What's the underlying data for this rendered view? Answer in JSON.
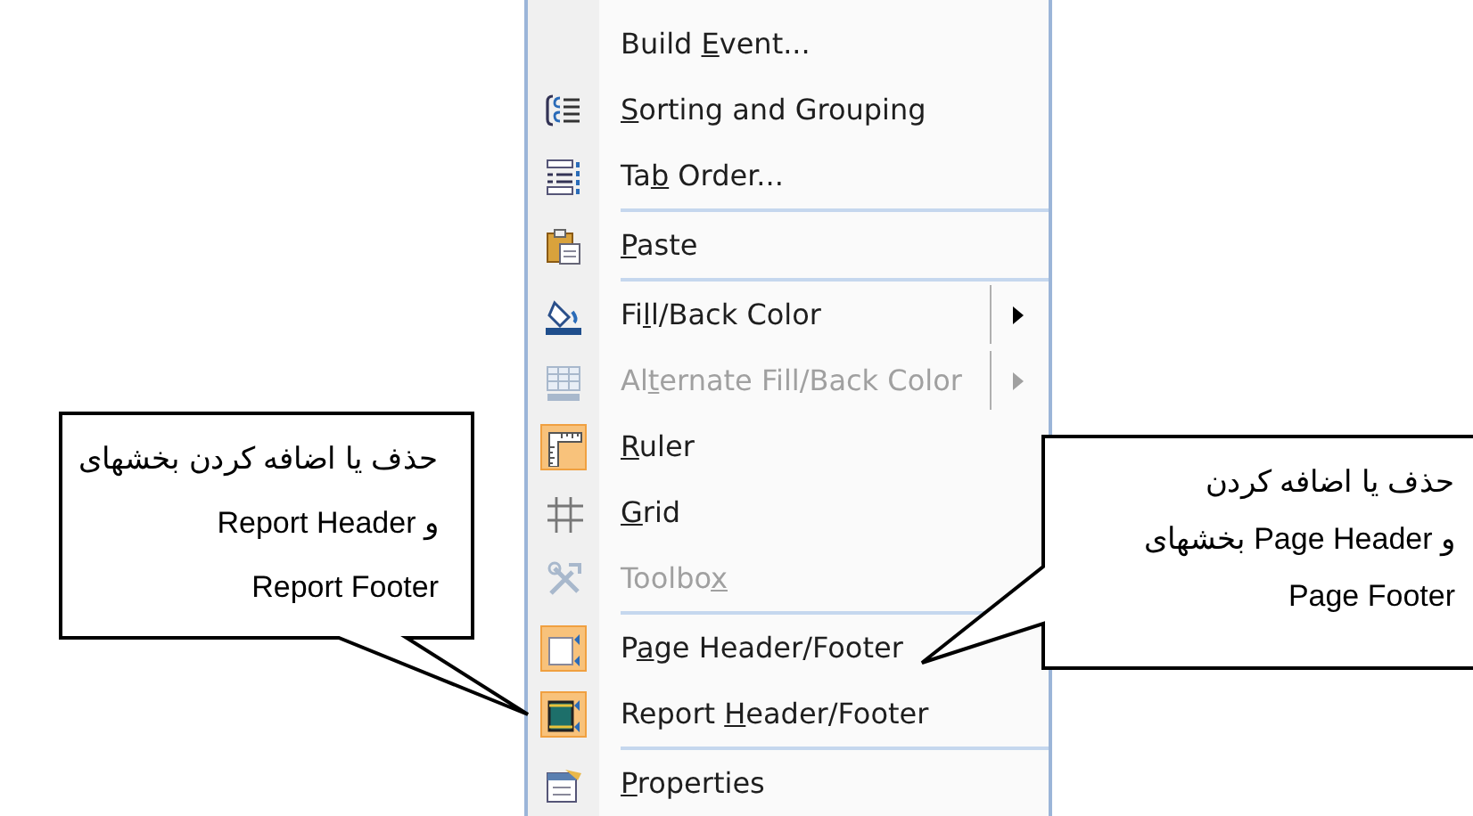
{
  "menu": {
    "items": [
      {
        "kind": "command",
        "label": {
          "before": "Build ",
          "key": "E",
          "after": "vent..."
        },
        "disabled": false,
        "checked": false,
        "submenu": false
      },
      {
        "kind": "command",
        "label": {
          "key": "S",
          "after": "orting and Grouping"
        },
        "disabled": false,
        "checked": false,
        "submenu": false
      },
      {
        "kind": "command",
        "label": {
          "before": "Ta",
          "key": "b",
          "after": " Order..."
        },
        "disabled": false,
        "checked": false,
        "submenu": false
      },
      {
        "kind": "separator"
      },
      {
        "kind": "command",
        "label": {
          "key": "P",
          "after": "aste"
        },
        "disabled": false,
        "checked": false,
        "submenu": false
      },
      {
        "kind": "separator"
      },
      {
        "kind": "command",
        "label": {
          "before": "Fi",
          "key": "l",
          "after": "l/Back Color"
        },
        "disabled": false,
        "checked": false,
        "submenu": true
      },
      {
        "kind": "command",
        "label": {
          "before": "Al",
          "key": "t",
          "after": "ernate Fill/Back Color"
        },
        "disabled": true,
        "checked": false,
        "submenu": true
      },
      {
        "kind": "command",
        "label": {
          "key": "R",
          "after": "uler"
        },
        "disabled": false,
        "checked": true,
        "submenu": false
      },
      {
        "kind": "command",
        "label": {
          "key": "G",
          "after": "rid"
        },
        "disabled": false,
        "checked": false,
        "submenu": false
      },
      {
        "kind": "command",
        "label": {
          "before": "Toolbo",
          "key": "x"
        },
        "disabled": true,
        "checked": false,
        "submenu": false
      },
      {
        "kind": "separator"
      },
      {
        "kind": "command",
        "label": {
          "before": "P",
          "key": "a",
          "after": "ge Header/Footer"
        },
        "disabled": false,
        "checked": true,
        "submenu": false
      },
      {
        "kind": "command",
        "label": {
          "before": "Report ",
          "key": "H",
          "after": "eader/Footer"
        },
        "disabled": false,
        "checked": true,
        "submenu": false
      },
      {
        "kind": "separator"
      },
      {
        "kind": "command",
        "label": {
          "key": "P",
          "after": "roperties"
        },
        "disabled": false,
        "checked": false,
        "submenu": false
      }
    ]
  },
  "callouts": [
    {
      "lines": [
        "حذف یا اضافه کردن بخشهای",
        "و Report Header",
        "Report Footer"
      ]
    },
    {
      "lines": [
        "حذف یا اضافه کردن",
        "و Page Header  بخشهای",
        "Page Footer"
      ]
    }
  ]
}
